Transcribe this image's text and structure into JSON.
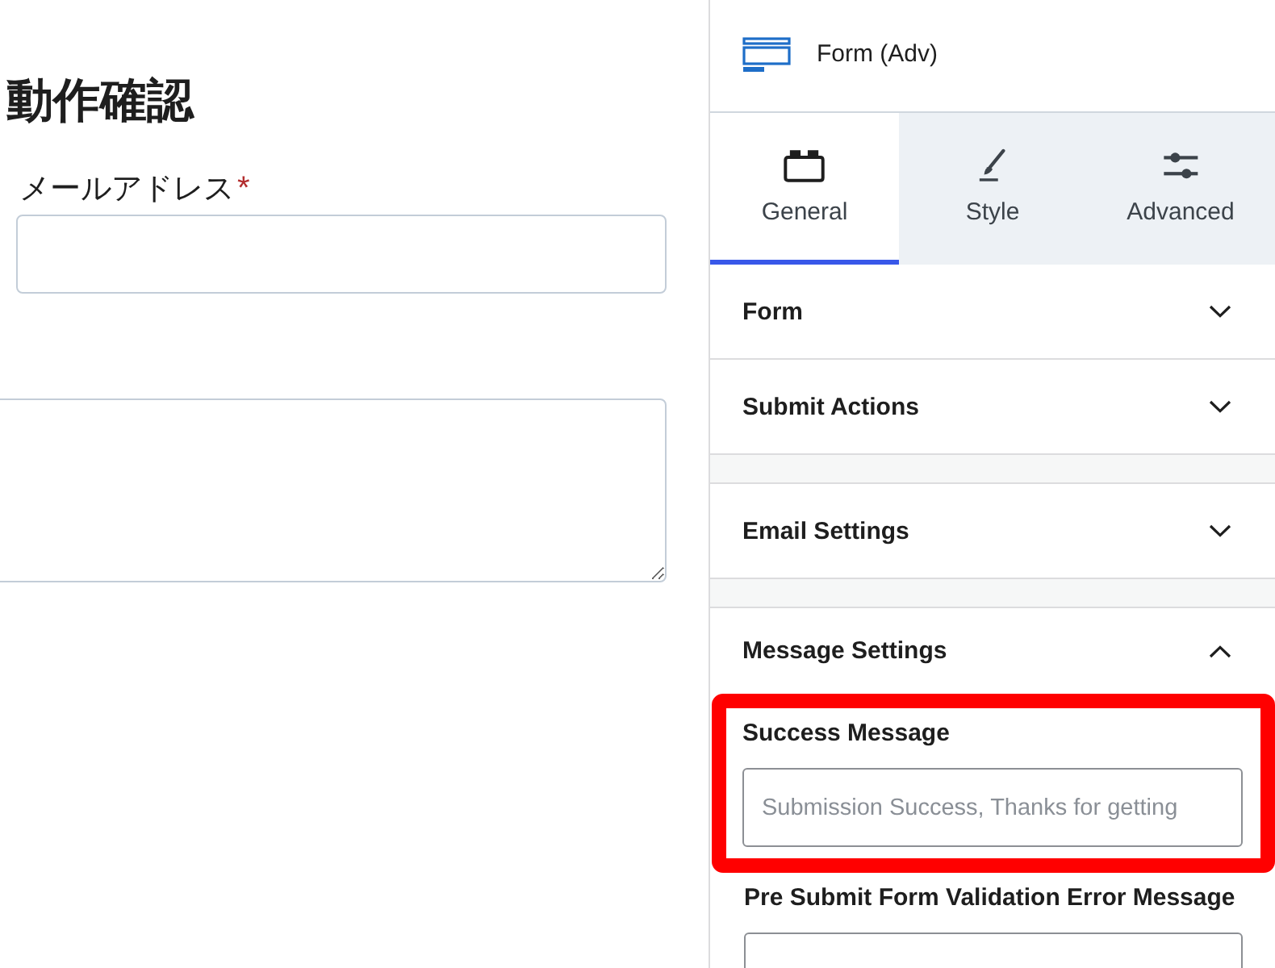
{
  "editor": {
    "heading": "動作確認",
    "fields": [
      {
        "kind": "input",
        "label": "メールアドレス",
        "required_mark": "*"
      },
      {
        "kind": "textarea"
      }
    ]
  },
  "sidebar": {
    "block": {
      "title": "Form (Adv)"
    },
    "tabs": [
      {
        "label": "General",
        "selected": true
      },
      {
        "label": "Style",
        "selected": false
      },
      {
        "label": "Advanced",
        "selected": false
      }
    ],
    "panel_groups": [
      [
        {
          "title": "Form",
          "expanded": false
        },
        {
          "title": "Submit Actions",
          "expanded": false
        }
      ],
      [
        {
          "title": "Email Settings",
          "expanded": false
        }
      ],
      [
        {
          "title": "Message Settings",
          "expanded": true,
          "fields": [
            {
              "label": "Success Message",
              "placeholder": "Submission Success, Thanks for getting",
              "highlighted": true
            },
            {
              "label": "Pre Submit Form Validation Error Message",
              "highlighted": false
            }
          ]
        }
      ]
    ]
  }
}
